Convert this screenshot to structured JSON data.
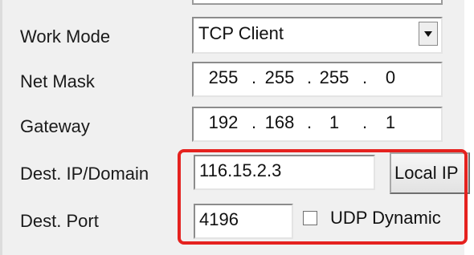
{
  "labels": {
    "work_mode": "Work Mode",
    "net_mask": "Net Mask",
    "gateway": "Gateway",
    "dest_ip": "Dest. IP/Domain",
    "dest_port": "Dest. Port"
  },
  "work_mode": {
    "value": "TCP Client"
  },
  "net_mask": [
    "255",
    "255",
    "255",
    "0"
  ],
  "gateway": [
    "192",
    "168",
    "1",
    "1"
  ],
  "dest_ip": {
    "value": "116.15.2.3"
  },
  "local_ip_button": "Local IP",
  "dest_port": {
    "value": "4196"
  },
  "udp_dynamic": {
    "label": "UDP Dynamic",
    "checked": false
  },
  "ip_separator": ".",
  "colors": {
    "highlight": "#e5221f",
    "panel": "#f0f0f0"
  },
  "icons": {
    "dropdown": "chevron-down-icon"
  }
}
